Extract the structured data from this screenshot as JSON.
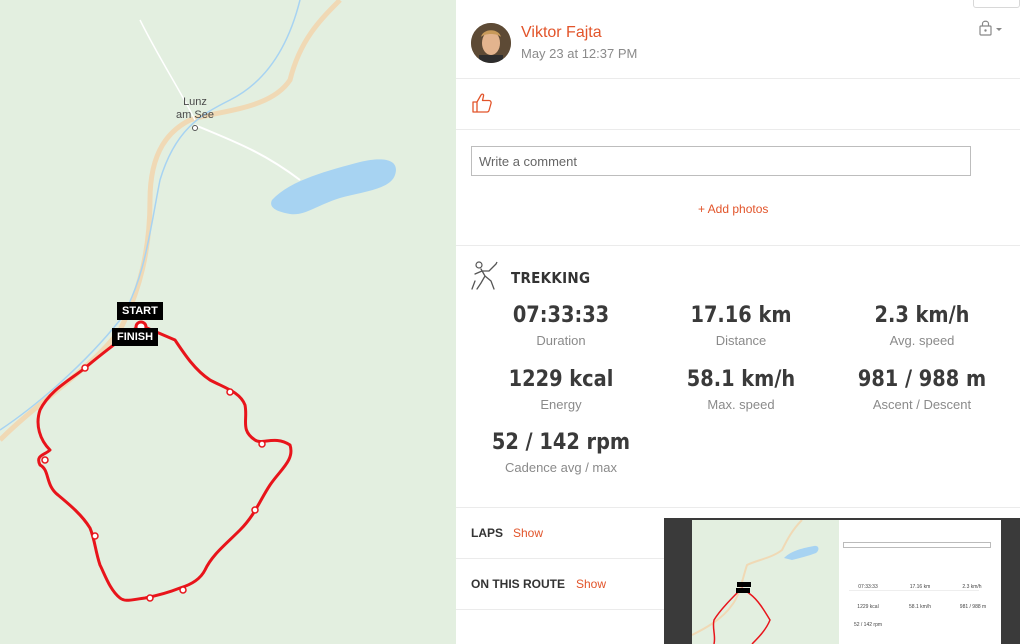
{
  "map": {
    "town_label_line1": "Lunz",
    "town_label_line2": "am See",
    "start_label": "START",
    "finish_label": "FINISH",
    "colors": {
      "land": "#e3efe0",
      "water": "#a7d3f2",
      "route": "#e8141b",
      "road": "#f0d9b5"
    }
  },
  "post": {
    "user_name": "Viktor Fajta",
    "timestamp": "May 23 at 12:37 PM",
    "privacy_icon": "lock-icon",
    "like_icon": "thumbs-up-icon"
  },
  "comment": {
    "placeholder": "Write a comment",
    "add_photos_label": "+ Add photos"
  },
  "workout": {
    "sport_icon": "hiker-icon",
    "sport": "TREKKING",
    "stats": [
      {
        "value": "07:33:33",
        "label": "Duration"
      },
      {
        "value": "17.16 km",
        "label": "Distance"
      },
      {
        "value": "2.3 km/h",
        "label": "Avg. speed"
      },
      {
        "value": "1229 kcal",
        "label": "Energy"
      },
      {
        "value": "58.1 km/h",
        "label": "Max. speed"
      },
      {
        "value": "981 / 988 m",
        "label": "Ascent / Descent"
      },
      {
        "value": "52 / 142 rpm",
        "label": "Cadence avg / max"
      }
    ]
  },
  "sections": {
    "laps_label": "LAPS",
    "laps_show": "Show",
    "route_label": "ON THIS ROUTE",
    "route_show": "Show"
  },
  "accent_color": "#e2542a"
}
